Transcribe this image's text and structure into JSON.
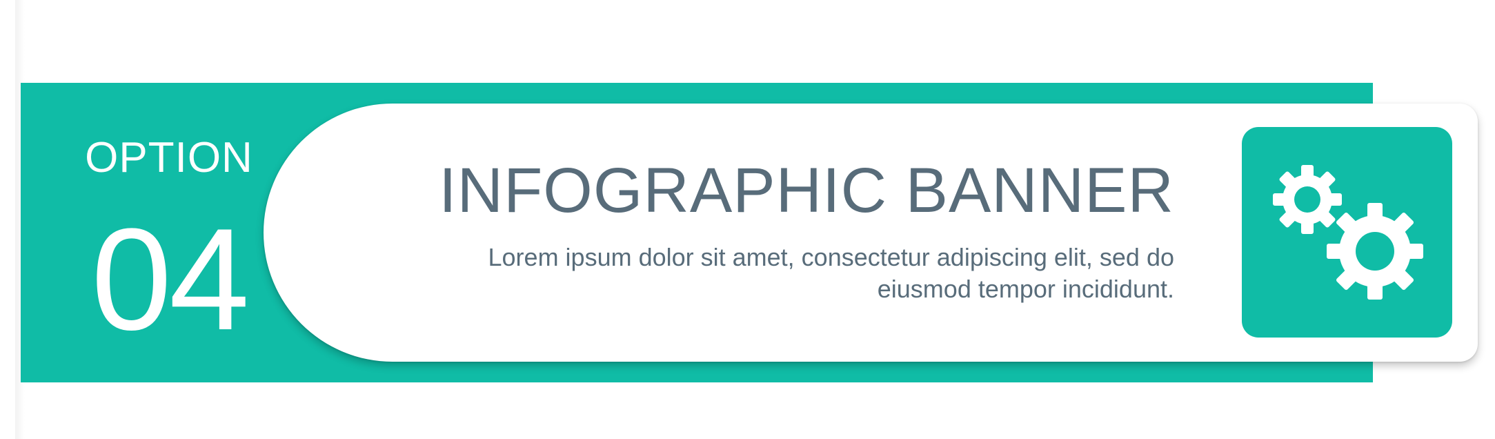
{
  "banner": {
    "option_label": "OPTION",
    "option_number": "04",
    "title": "INFOGRAPHIC BANNER",
    "description": "Lorem ipsum dolor sit amet, consectetur adipiscing elit, sed do eiusmod tempor incididunt.",
    "icon": "gears-icon"
  },
  "colors": {
    "accent": "#10bca6",
    "text": "#586c7a",
    "card": "#ffffff"
  }
}
